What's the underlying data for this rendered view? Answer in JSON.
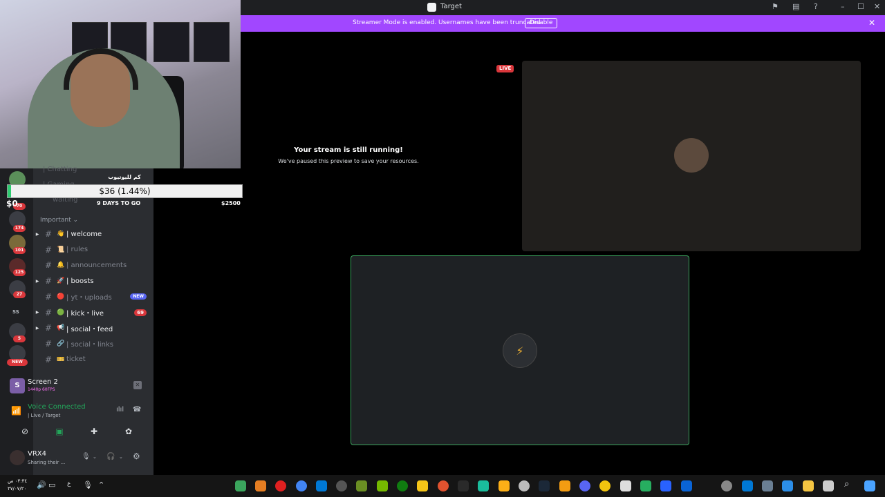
{
  "titlebar": {
    "app_title": "Target"
  },
  "streamer_mode": {
    "message": "Streamer Mode is enabled. Usernames have been truncated.",
    "button": "Disable",
    "close": "✕"
  },
  "stream_paused": {
    "title": "Your stream is still running!",
    "subtitle": "We've paused this preview to save your resources."
  },
  "live_badge": "LIVE",
  "donation": {
    "title": "كم لليوتيوب",
    "amount": "$36 (1.44%)",
    "progress_fraction": 0.0144,
    "start": "$0",
    "days_left": "9 DAYS TO GO",
    "goal": "$2500"
  },
  "rail": {
    "badges": [
      "70",
      "174",
      "101",
      "125",
      "27",
      "5"
    ],
    "server_text": "SS",
    "new_label": "NEW"
  },
  "sidebar": {
    "ghost_channels": [
      "| Chatting",
      "| Gaming",
      "waiting"
    ],
    "category": "Important ⌄",
    "channels": [
      {
        "emoji": "👋",
        "name": "| welcome",
        "bright": true,
        "arrow": true
      },
      {
        "emoji": "📜",
        "name": "| rules",
        "bright": false,
        "arrow": false
      },
      {
        "emoji": "🔔",
        "name": "| announcements",
        "bright": false,
        "arrow": false
      },
      {
        "emoji": "🚀",
        "name": "| boosts",
        "bright": true,
        "arrow": true
      },
      {
        "emoji": "🔴",
        "name": "| yt・uploads",
        "bright": false,
        "arrow": false,
        "pill_new": "NEW"
      },
      {
        "emoji": "🟢",
        "name": "| kick・live",
        "bright": true,
        "arrow": true,
        "pill_count": "69"
      },
      {
        "emoji": "📢",
        "name": "| social・feed",
        "bright": true,
        "arrow": true
      },
      {
        "emoji": "🔗",
        "name": "| social・links",
        "bright": false,
        "arrow": false
      },
      {
        "emoji": "🎫",
        "name": "ticket",
        "bright": false,
        "arrow": false
      }
    ]
  },
  "screen_share": {
    "icon_letter": "S",
    "title": "Screen 2",
    "subtitle": "1440p 60FPS"
  },
  "voice": {
    "title": "Voice Connected",
    "subtitle": "| Live / Target"
  },
  "user": {
    "name": "VRX4",
    "status": "Sharing their ..."
  },
  "taskbar": {
    "time": "٠٣:٣٤ ص",
    "date": "٢٧/٠٧/٢٠"
  },
  "colors": {
    "accent": "#a147ff",
    "voice_green": "#23a55a",
    "live_red": "#da373c",
    "sidebar_bg": "#2b2d31"
  }
}
